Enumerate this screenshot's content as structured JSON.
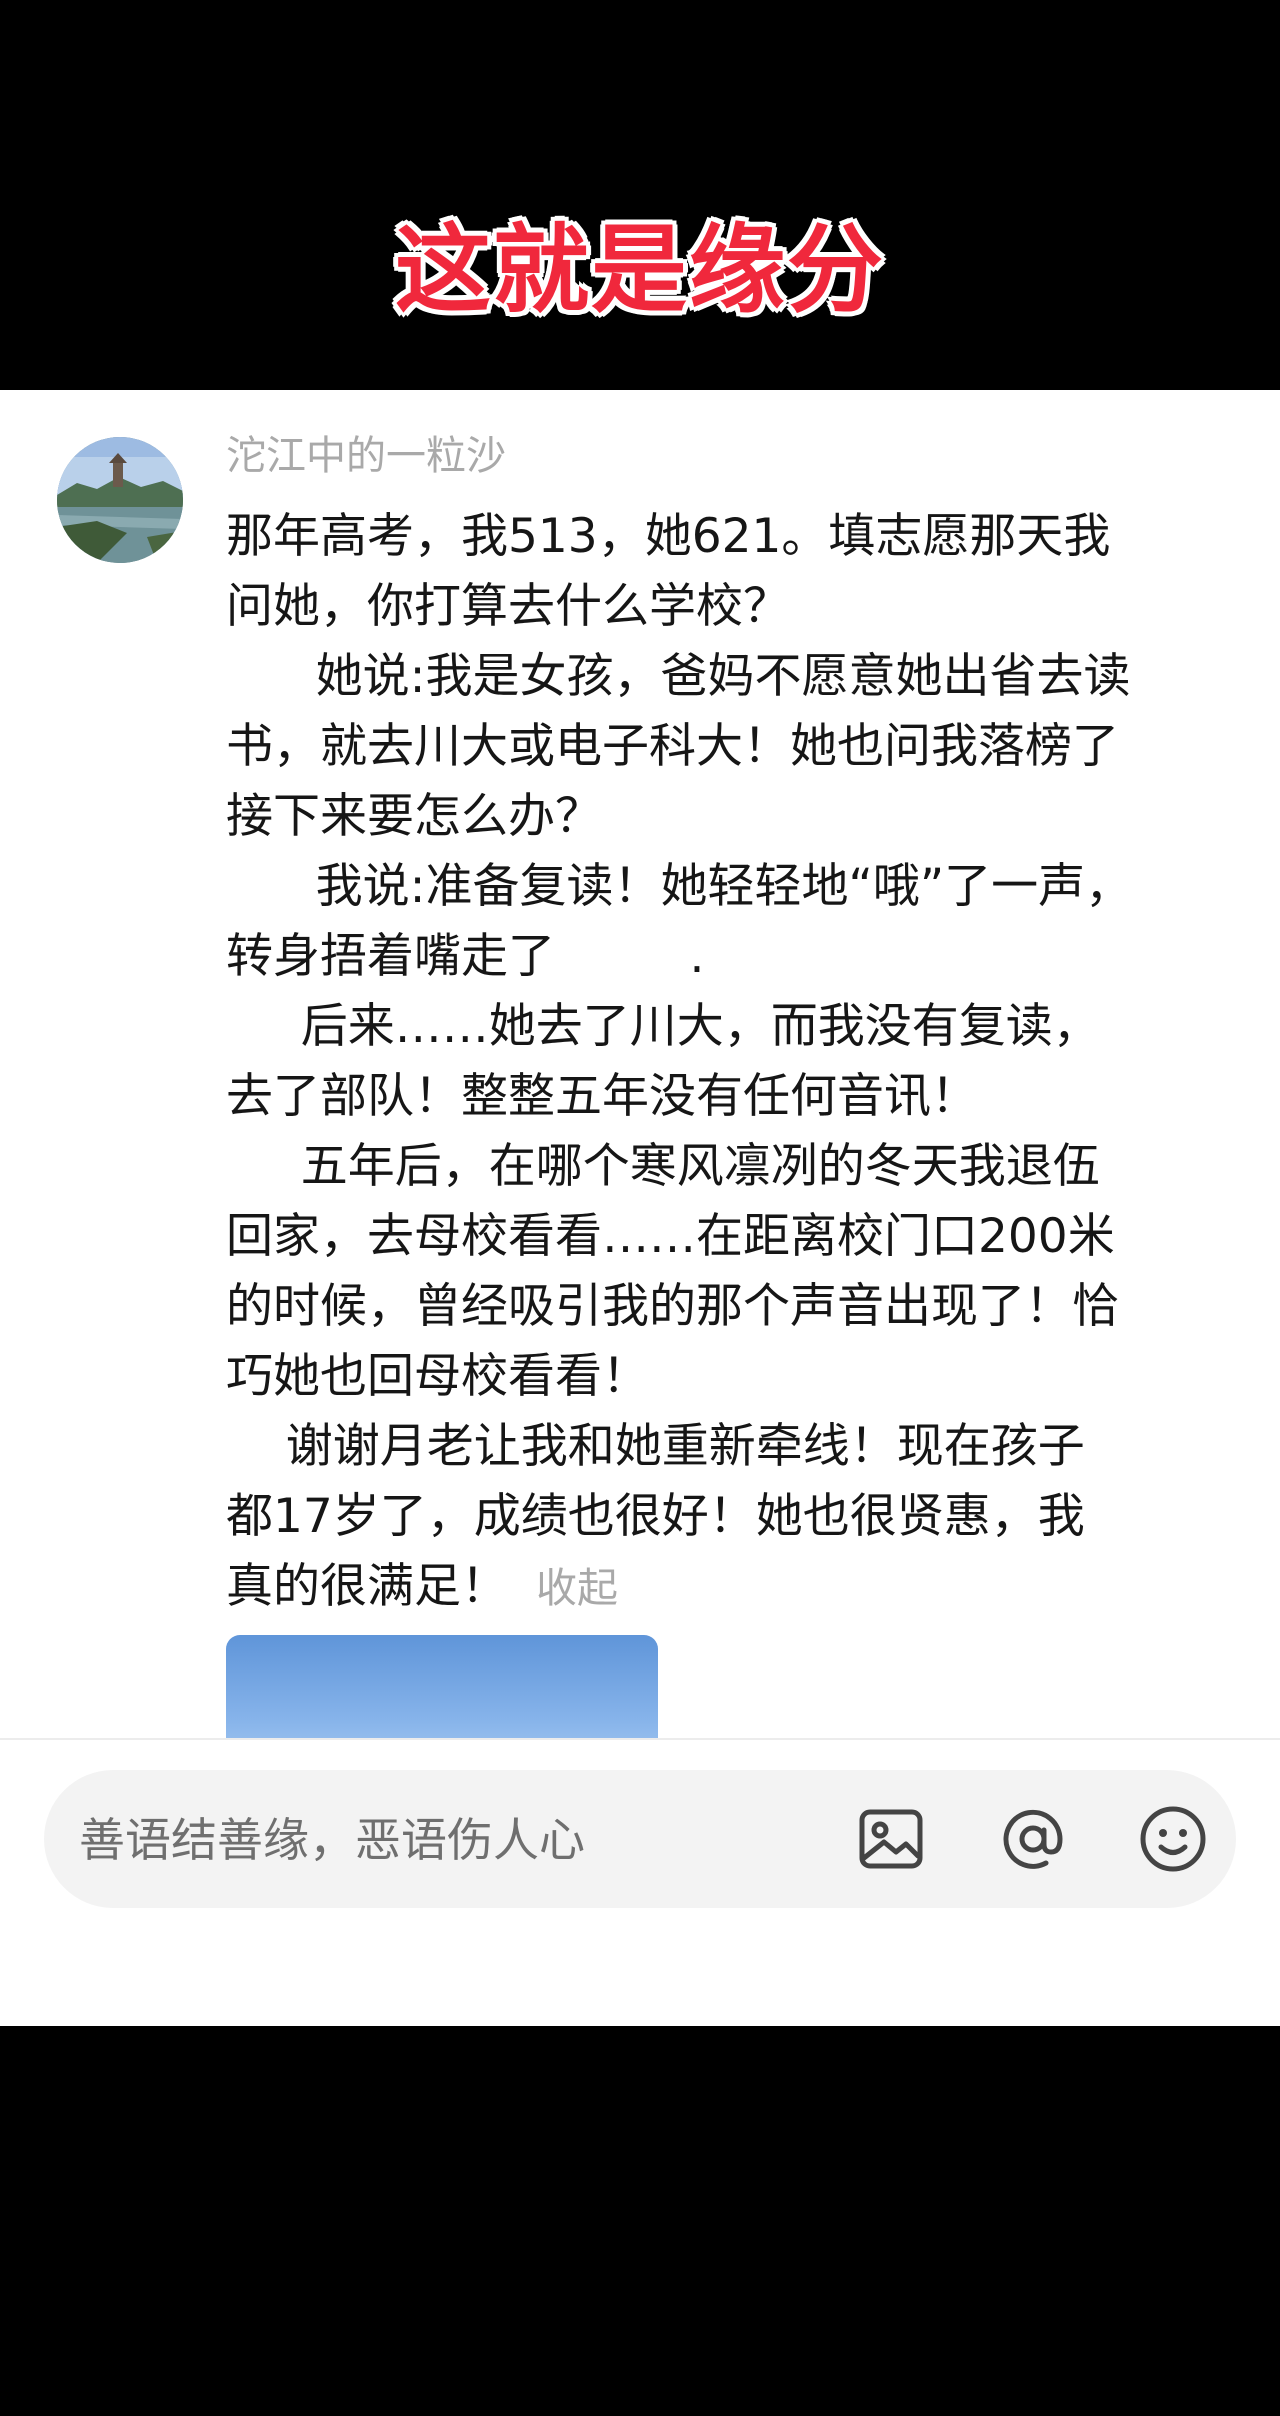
{
  "video": {
    "title": "这就是缘分"
  },
  "comment": {
    "username": "沱江中的一粒沙",
    "lines": [
      "那年高考，我513，她621。填志愿那天我",
      "问她，你打算去什么学校？",
      "      她说:我是女孩，爸妈不愿意她出省去读",
      "书，就去川大或电子科大！她也问我落榜了",
      "接下来要怎么办？",
      "      我说:准备复读！她轻轻地“哦”了一声，",
      "转身捂着嘴走了         .",
      "     后来……她去了川大，而我没有复读，",
      "去了部队！整整五年没有任何音讯！",
      "     五年后，在哪个寒风凛冽的冬天我退伍",
      "回家，去母校看看……在距离校门口200米",
      "的时候，曾经吸引我的那个声音出现了！恰",
      "巧她也回母校看看！",
      "    谢谢月老让我和她重新牵线！现在孩子",
      "都17岁了，成绩也很好！她也很贤惠，我",
      "真的很满足！"
    ],
    "collapse_label": "收起"
  },
  "input_bar": {
    "placeholder": "善语结善缘，恶语伤人心"
  },
  "icons": {
    "image": "image-icon",
    "at": "at-icon",
    "emoji": "emoji-icon"
  },
  "colors": {
    "title_red": "#f0283c",
    "username_gray": "#a9a9a9",
    "text": "#161616",
    "input_bg": "#f3f3f3"
  }
}
